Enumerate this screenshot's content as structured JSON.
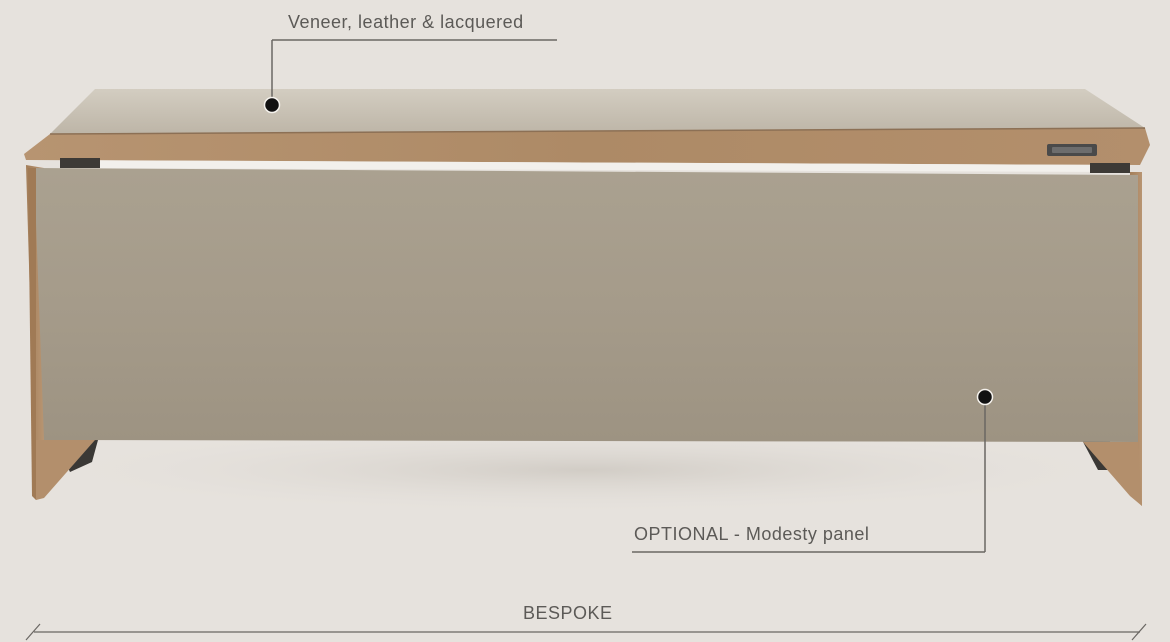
{
  "annotations": {
    "top_finish": "Veneer, leather & lacquered",
    "modesty_panel": "OPTIONAL - Modesty panel"
  },
  "dimension": {
    "width_label": "BESPOKE"
  },
  "colors": {
    "background": "#e6e2dd",
    "desk_top": "#c7c0b3",
    "wood_edge": "#b08c68",
    "panel": "#a49a88",
    "leader_line": "#5c5a57",
    "dot": "#111111"
  }
}
